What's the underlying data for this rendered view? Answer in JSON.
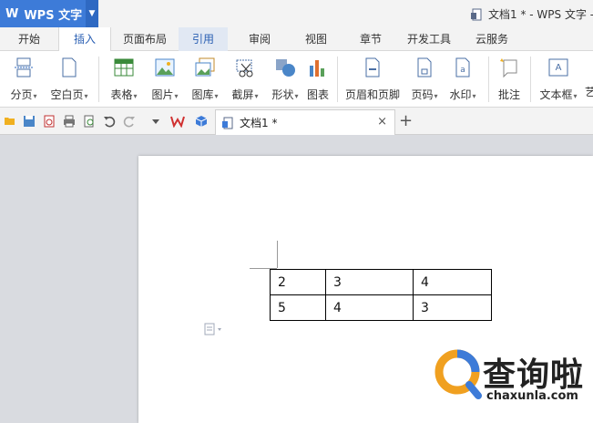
{
  "app": {
    "brand_label": "WPS 文字",
    "brand_logo": "W",
    "window_title": "文档1 * - WPS 文字 -"
  },
  "menu": {
    "tabs": [
      "开始",
      "插入",
      "页面布局",
      "引用",
      "审阅",
      "视图",
      "章节",
      "开发工具",
      "云服务"
    ],
    "active": "插入"
  },
  "ribbon": {
    "buttons": [
      {
        "label": "分页",
        "dropdown": true,
        "icon": "page-break-icon"
      },
      {
        "label": "空白页",
        "dropdown": true,
        "icon": "blank-page-icon"
      },
      {
        "label": "表格",
        "dropdown": true,
        "icon": "table-icon"
      },
      {
        "label": "图片",
        "dropdown": true,
        "icon": "picture-icon"
      },
      {
        "label": "图库",
        "dropdown": true,
        "icon": "gallery-icon"
      },
      {
        "label": "截屏",
        "dropdown": true,
        "icon": "screenshot-icon"
      },
      {
        "label": "形状",
        "dropdown": true,
        "icon": "shapes-icon"
      },
      {
        "label": "图表",
        "dropdown": false,
        "icon": "chart-icon"
      },
      {
        "label": "页眉和页脚",
        "dropdown": false,
        "icon": "header-footer-icon"
      },
      {
        "label": "页码",
        "dropdown": true,
        "icon": "page-number-icon"
      },
      {
        "label": "水印",
        "dropdown": true,
        "icon": "watermark-icon"
      },
      {
        "label": "批注",
        "dropdown": false,
        "icon": "comment-icon"
      },
      {
        "label": "文本框",
        "dropdown": true,
        "icon": "textbox-icon"
      },
      {
        "label": "艺",
        "dropdown": false,
        "icon": "art-text-icon"
      }
    ]
  },
  "doc_tab": {
    "title": "文档1 *",
    "close": "×",
    "new_tab": "+"
  },
  "table": {
    "rows": [
      [
        "2",
        "3",
        "4"
      ],
      [
        "5",
        "4",
        "3"
      ]
    ]
  },
  "watermark": {
    "brand": "查询啦",
    "url": "chaxunla.com"
  },
  "colors": {
    "brand_blue": "#3d7bd8",
    "active_tab_text": "#2a5fb3"
  }
}
